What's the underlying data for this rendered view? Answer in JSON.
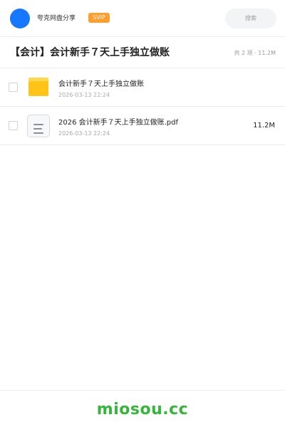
{
  "header": {
    "app_name": "夸克网盘分享",
    "badge": "SVIP",
    "search_placeholder": "搜索",
    "accent_color": "#1677ff",
    "badge_color": "#ff9e2c"
  },
  "share": {
    "title": "【会计】会计新手７天上手独立做账",
    "meta": "共 2 项 · 11.2M"
  },
  "files": [
    {
      "type": "folder",
      "icon": "folder-icon",
      "name": "会计新手７天上手独立做账",
      "date": "2026-03-13 22:24",
      "size": ""
    },
    {
      "type": "pdf",
      "icon": "document-icon",
      "name": "2026 会计新手７天上手独立做账.pdf",
      "date": "2026-03-13 22:24",
      "size": "11.2M"
    }
  ],
  "footer": {
    "watermark": "miosou.cc",
    "watermark_color": "#35b53a"
  }
}
